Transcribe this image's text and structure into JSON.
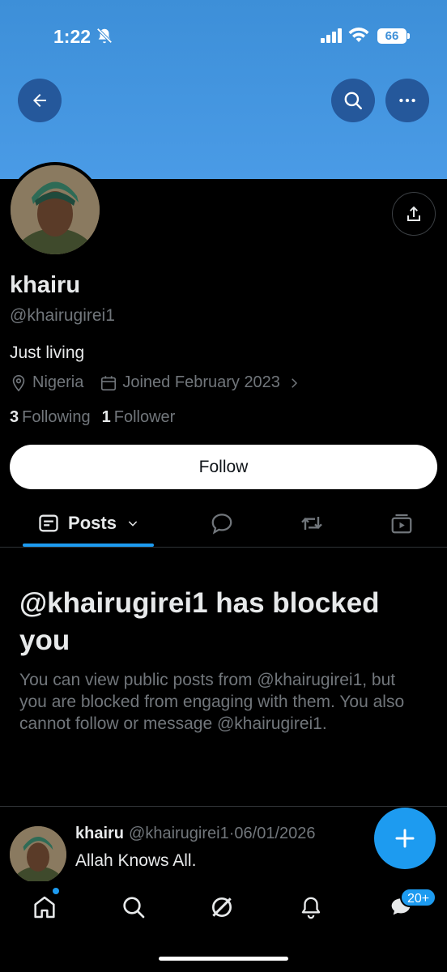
{
  "status_bar": {
    "time": "1:22",
    "battery": "66"
  },
  "profile": {
    "name": "khairu",
    "handle": "@khairugirei1",
    "bio": "Just living",
    "location": "Nigeria",
    "joined": "Joined February 2023",
    "following_count": "3",
    "following_label": "Following",
    "followers_count": "1",
    "followers_label": "Follower",
    "follow_label": "Follow"
  },
  "tabs": {
    "posts_label": "Posts"
  },
  "blocked": {
    "title": "@khairugirei1 has blocked you",
    "body": "You can view public posts from @khairugirei1, but you are blocked from engaging with them. You also cannot follow or message @khairugirei1."
  },
  "post": {
    "name": "khairu",
    "handle": "@khairugirei1",
    "separator": "·",
    "date": "06/01/2026",
    "text": "Allah Knows All."
  },
  "nav": {
    "messages_badge": "20+"
  },
  "colors": {
    "accent": "#1d9bf0",
    "banner": "#4a9be6",
    "muted": "#71767b"
  }
}
